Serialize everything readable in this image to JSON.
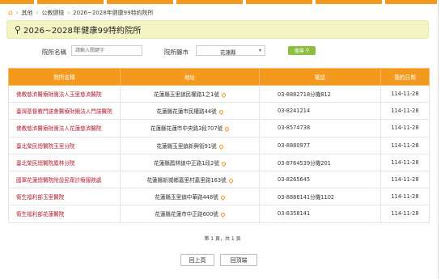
{
  "breadcrumb": {
    "items": [
      "其他",
      "公教健檢",
      "2026~2028年健康99特約院所"
    ]
  },
  "title": "2026~2028年健康99特約院所",
  "search": {
    "name_label": "院所名稱",
    "name_placeholder": "請輸入關鍵字",
    "city_label": "院所縣市",
    "city_value": "花蓮縣",
    "button_label": "搜尋"
  },
  "table": {
    "headers": [
      "院所名稱",
      "地址",
      "電話",
      "簽約日期"
    ],
    "rows": [
      {
        "name": "佛教慈濟醫療財團法人玉里慈濟醫院",
        "address": "花蓮縣玉里鎮民權路1之1號",
        "phone": "03-8882718分機812",
        "date": "114-11-28"
      },
      {
        "name": "臺灣基督教門諾會醫療財團法人門諾醫院",
        "address": "花蓮縣花蓮市民權路44號",
        "phone": "03-8241214",
        "date": "114-11-28"
      },
      {
        "name": "佛教慈濟醫療財團法人花蓮慈濟醫院",
        "address": "花蓮縣花蓮市中央路3段707號",
        "phone": "03-8574738",
        "date": "114-11-28"
      },
      {
        "name": "臺北榮民總醫院玉里分院",
        "address": "花蓮縣玉里鎮新興街91號",
        "phone": "03-8880977",
        "date": "114-11-28"
      },
      {
        "name": "臺北榮民總醫院鳳林分院",
        "address": "花蓮縣鳳林鎮中正路1段2號",
        "phone": "03-8764539分機201",
        "date": "114-11-28"
      },
      {
        "name": "國軍花蓮總醫院附設民眾診療服務處",
        "address": "花蓮縣新城鄉嘉里村嘉里路163號",
        "phone": "03-8265645",
        "date": "114-11-28"
      },
      {
        "name": "衛生福利部玉里醫院",
        "address": "花蓮縣玉里鎮中華路448號",
        "phone": "03-8886141分機1102",
        "date": "114-11-28"
      },
      {
        "name": "衛生福利部花蓮醫院",
        "address": "花蓮縣花蓮市中正路600號",
        "phone": "03-8358141",
        "date": "114-11-28"
      }
    ]
  },
  "pagination": {
    "info": "第 1 頁，共 1 頁"
  },
  "nav": {
    "back_label": "回上頁",
    "top_label": "回頂端"
  },
  "colors": {
    "accent": "#f39a1e",
    "title_bg": "#f2f4c4",
    "button": "#8cbf3f",
    "link_red": "#b22330"
  }
}
